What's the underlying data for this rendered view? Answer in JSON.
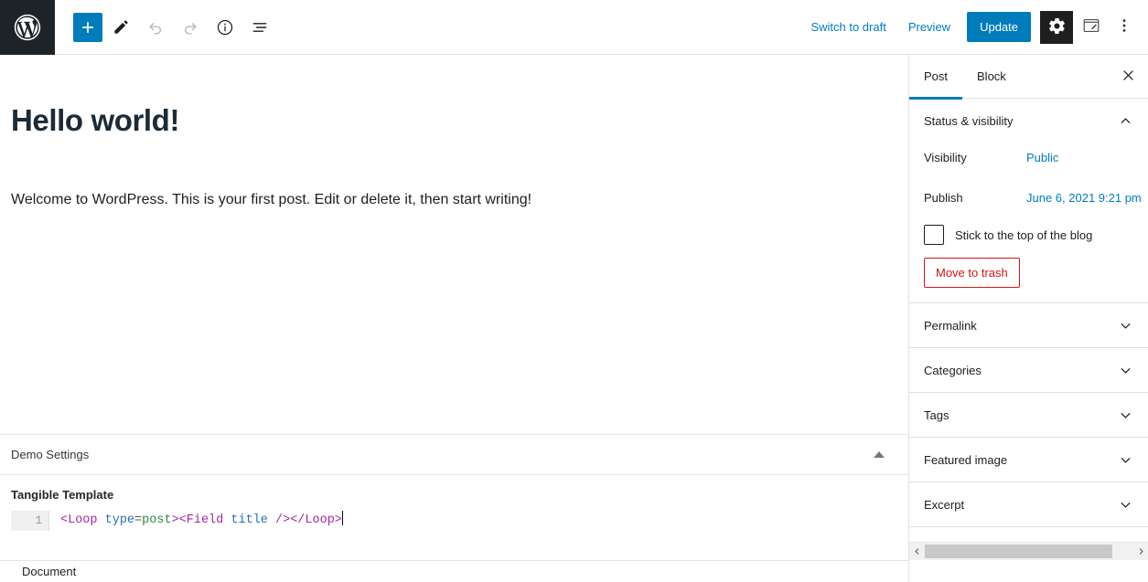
{
  "toolbar": {
    "logo_icon": "wordpress-logo-icon",
    "add_block_label": "+",
    "add_block_icon": "plus-icon",
    "edit_tool_icon": "pencil-icon",
    "undo_icon": "undo-arrow-icon",
    "redo_icon": "redo-arrow-icon",
    "info_icon": "info-circle-icon",
    "list_view_icon": "list-view-icon",
    "switch_to_draft_label": "Switch to draft",
    "preview_label": "Preview",
    "update_label": "Update",
    "settings_icon": "gear-icon",
    "jetpack_icon": "edit-square-icon",
    "more_options_icon": "vertical-ellipsis-icon"
  },
  "post": {
    "title": "Hello world!",
    "paragraph": "Welcome to WordPress. This is your first post. Edit or delete it, then start writing!"
  },
  "metabox": {
    "title": "Demo Settings",
    "collapse_icon": "triangle-up-icon",
    "field_label": "Tangible Template",
    "code": {
      "line_number": "1",
      "full_text": "<Loop type=post><Field title /></Loop>",
      "tokens": [
        {
          "text": "<Loop",
          "type": "tag"
        },
        {
          "text": " ",
          "type": "plain"
        },
        {
          "text": "type",
          "type": "attr"
        },
        {
          "text": "=",
          "type": "punct"
        },
        {
          "text": "post",
          "type": "val"
        },
        {
          "text": ">",
          "type": "tag"
        },
        {
          "text": "<Field",
          "type": "tag"
        },
        {
          "text": " ",
          "type": "plain"
        },
        {
          "text": "title",
          "type": "attr"
        },
        {
          "text": " />",
          "type": "tag"
        },
        {
          "text": "</Loop>",
          "type": "tag"
        }
      ]
    }
  },
  "document_bar": {
    "label": "Document"
  },
  "sidebar": {
    "tabs": [
      {
        "label": "Post",
        "active": true
      },
      {
        "label": "Block",
        "active": false
      }
    ],
    "close_icon": "close-icon",
    "status_panel": {
      "title": "Status & visibility",
      "expanded": true,
      "chevron_icon": "chevron-up-icon",
      "visibility_label": "Visibility",
      "visibility_value": "Public",
      "publish_label": "Publish",
      "publish_value": "June 6, 2021 9:21 pm",
      "sticky_label": "Stick to the top of the blog",
      "sticky_checked": false,
      "trash_label": "Move to trash"
    },
    "panels": [
      {
        "title": "Permalink",
        "chevron_icon": "chevron-down-icon"
      },
      {
        "title": "Categories",
        "chevron_icon": "chevron-down-icon"
      },
      {
        "title": "Tags",
        "chevron_icon": "chevron-down-icon"
      },
      {
        "title": "Featured image",
        "chevron_icon": "chevron-down-icon"
      },
      {
        "title": "Excerpt",
        "chevron_icon": "chevron-down-icon"
      }
    ],
    "scrollbar": {
      "left_arrow_icon": "chevron-left-icon",
      "right_arrow_icon": "chevron-right-icon"
    }
  },
  "colors": {
    "accent_blue": "#007cba",
    "admin_dark": "#1e2327",
    "danger_red": "#cc1818",
    "title_navy": "#1b2b37",
    "border_gray": "#e0e0e0"
  }
}
